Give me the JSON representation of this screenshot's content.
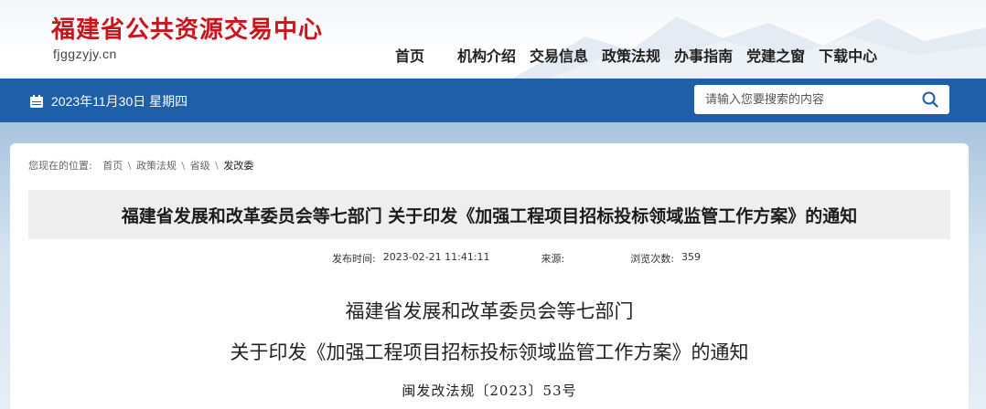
{
  "header": {
    "site_title": "福建省公共资源交易中心",
    "site_domain": "fjggzyjy.cn",
    "nav": [
      {
        "label": "首页"
      },
      {
        "label": "机构介绍"
      },
      {
        "label": "交易信息"
      },
      {
        "label": "政策法规"
      },
      {
        "label": "办事指南"
      },
      {
        "label": "党建之窗"
      },
      {
        "label": "下载中心"
      }
    ],
    "colors": {
      "title_red": "#c8161d"
    }
  },
  "topbar": {
    "date_icon": "calendar-icon",
    "date_text": "2023年11月30日 星期四",
    "search": {
      "placeholder": "请输入您要搜索的内容",
      "icon": "search-icon"
    },
    "colors": {
      "bar_blue": "#1e5fa8"
    }
  },
  "breadcrumb": {
    "prefix": "您现在的位置:",
    "items": [
      "首页",
      "政策法规",
      "省级",
      "发改委"
    ],
    "separator": "\\"
  },
  "article": {
    "title": "福建省发展和改革委员会等七部门 关于印发《加强工程项目招标投标领域监管工作方案》的通知",
    "meta": {
      "publish_label": "发布时间:",
      "publish_value": "2023-02-21 11:41:11",
      "source_label": "来源:",
      "source_value": "",
      "views_label": "浏览次数:",
      "views_value": "359"
    },
    "body_heading_line1": "福建省发展和改革委员会等七部门",
    "body_heading_line2": "关于印发《加强工程项目招标投标领域监管工作方案》的通知",
    "doc_number": "闽发改法规〔2023〕53号"
  }
}
